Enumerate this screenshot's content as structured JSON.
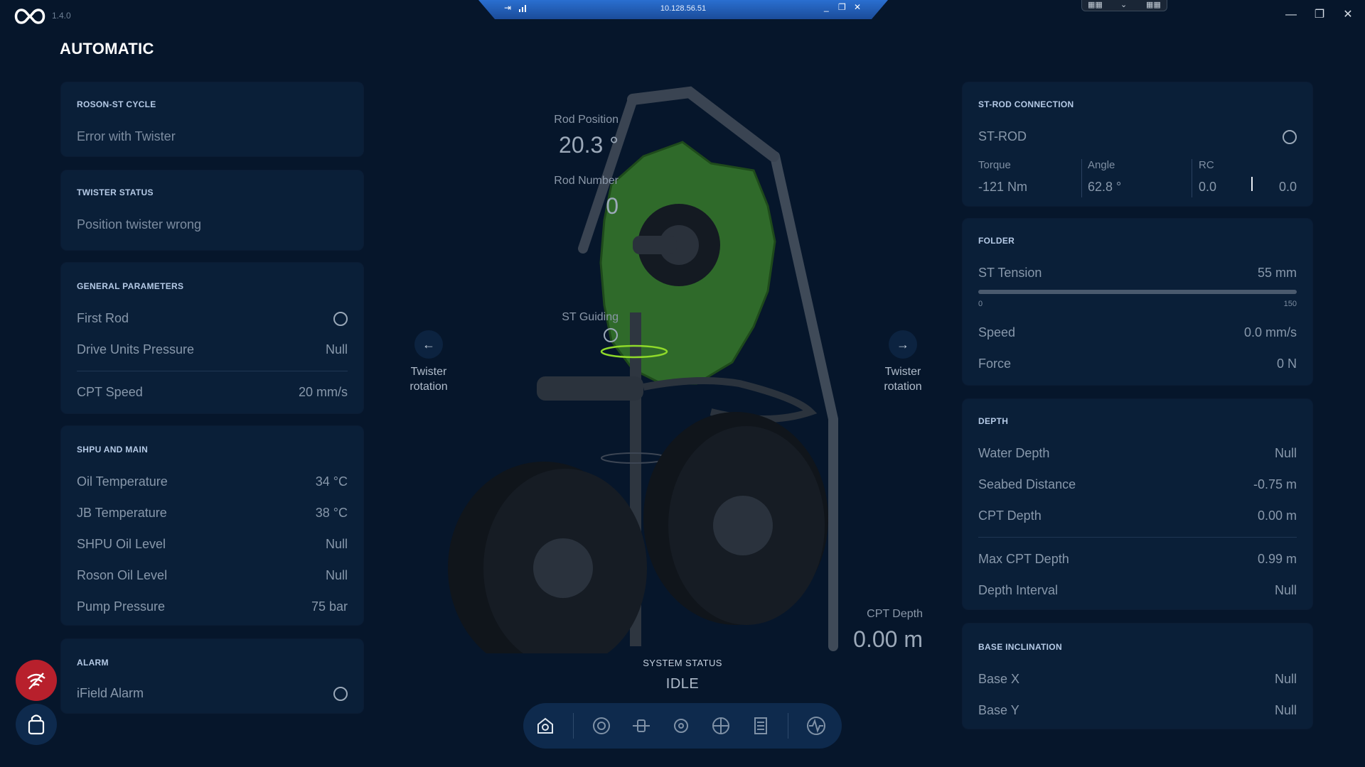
{
  "app": {
    "version": "1.4.0",
    "remote_ip": "10.128.56.51",
    "page_title": "AUTOMATIC"
  },
  "left": {
    "roson_cycle": {
      "title": "ROSON-ST CYCLE",
      "message": "Error with Twister"
    },
    "twister_status": {
      "title": "TWISTER STATUS",
      "message": "Position twister wrong"
    },
    "general": {
      "title": "GENERAL PARAMETERS",
      "rows": [
        {
          "label": "First Rod",
          "value": ""
        },
        {
          "label": "Drive Units Pressure",
          "value": "Null"
        },
        {
          "label": "CPT Speed",
          "value": "20 mm/s"
        }
      ]
    },
    "shpu": {
      "title": "SHPU AND MAIN",
      "rows": [
        {
          "label": "Oil Temperature",
          "value": "34 °C"
        },
        {
          "label": "JB Temperature",
          "value": "38 °C"
        },
        {
          "label": "SHPU Oil Level",
          "value": "Null"
        },
        {
          "label": "Roson Oil Level",
          "value": "Null"
        },
        {
          "label": "Pump Pressure",
          "value": "75 bar"
        }
      ]
    },
    "alarm": {
      "title": "ALARM",
      "label": "iField Alarm"
    }
  },
  "center": {
    "rod_position_label": "Rod Position",
    "rod_position_value": "20.3 °",
    "rod_number_label": "Rod Number",
    "rod_number_value": "0",
    "st_guiding_label": "ST Guiding",
    "twister_left_label": "Twister rotation",
    "twister_right_label": "Twister rotation",
    "cpt_depth_label": "CPT Depth",
    "cpt_depth_value": "0.00 m",
    "system_status_label": "SYSTEM STATUS",
    "system_status_value": "IDLE"
  },
  "right": {
    "st_rod": {
      "title": "ST-ROD CONNECTION",
      "label": "ST-ROD",
      "torque_label": "Torque",
      "torque_value": "-121 Nm",
      "angle_label": "Angle",
      "angle_value": "62.8 °",
      "rc_label": "RC",
      "rc_left": "0.0",
      "rc_right": "0.0"
    },
    "folder": {
      "title": "FOLDER",
      "tension_label": "ST Tension",
      "tension_value": "55 mm",
      "tension_min": "0",
      "tension_max": "150",
      "speed_label": "Speed",
      "speed_value": "0.0 mm/s",
      "force_label": "Force",
      "force_value": "0 N"
    },
    "depth": {
      "title": "DEPTH",
      "rows": [
        {
          "label": "Water Depth",
          "value": "Null"
        },
        {
          "label": "Seabed Distance",
          "value": "-0.75 m"
        },
        {
          "label": "CPT Depth",
          "value": "0.00 m"
        },
        {
          "label": "Max CPT Depth",
          "value": "0.99 m"
        },
        {
          "label": "Depth Interval",
          "value": "Null"
        }
      ]
    },
    "base": {
      "title": "BASE INCLINATION",
      "rows": [
        {
          "label": "Base X",
          "value": "Null"
        },
        {
          "label": "Base Y",
          "value": "Null"
        }
      ]
    }
  },
  "toolbar_icons": [
    "home-icon",
    "target-icon",
    "sliders-icon",
    "gear-icon",
    "settings-wheel-icon",
    "log-icon",
    "pulse-icon"
  ],
  "colors": {
    "background": "#06162b",
    "panel": "#0a1f38",
    "accent_blue": "#2a6fd0",
    "alarm_red": "#b8202c",
    "model_green": "#2f6a2a"
  }
}
